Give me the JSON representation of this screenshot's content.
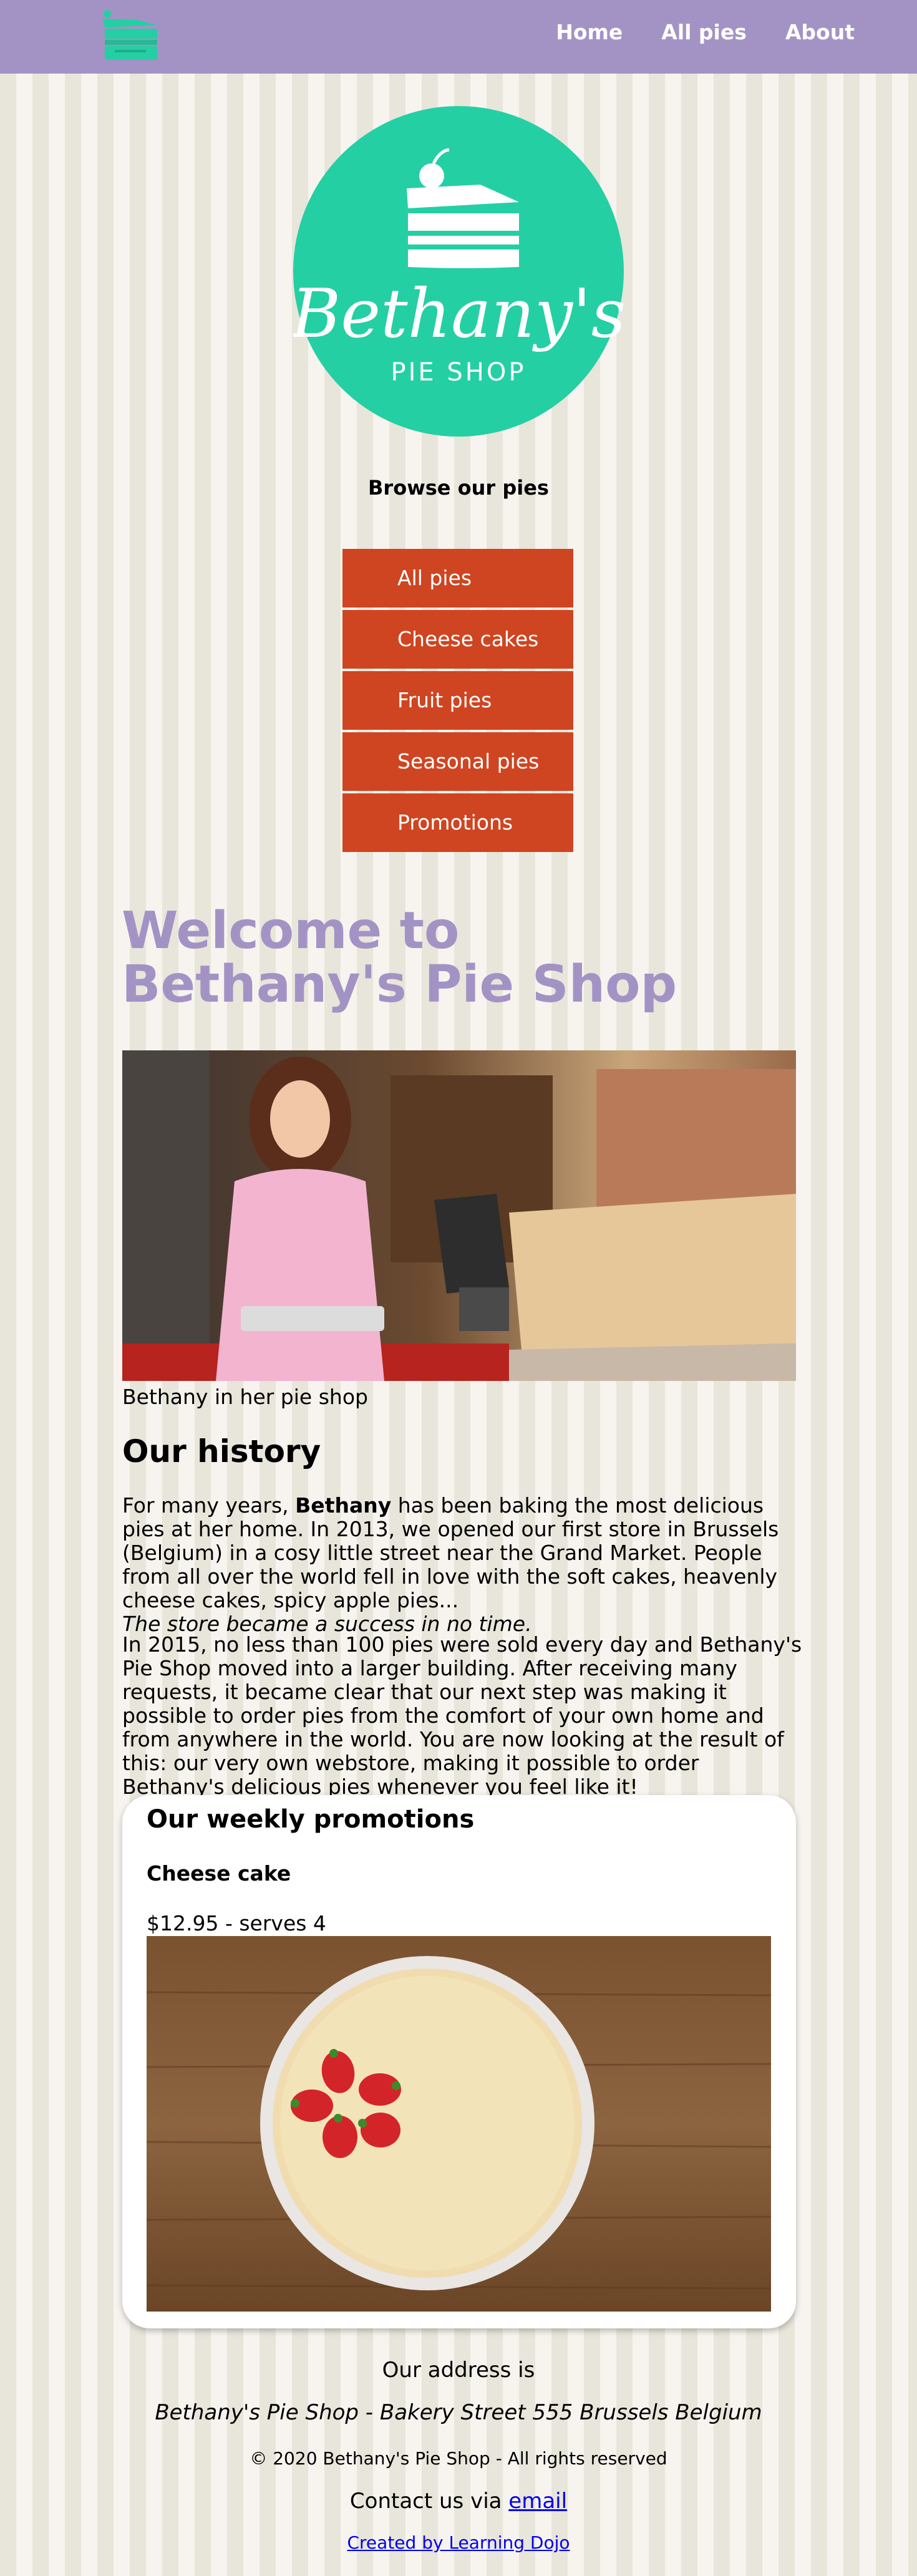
{
  "nav": {
    "logo_icon": "pie-slice-logo-icon",
    "links": [
      "Home",
      "All pies",
      "About"
    ]
  },
  "hero": {
    "brand_name": "Bethany's",
    "brand_sub": "PIE SHOP",
    "brand_color": "#24cfa4"
  },
  "browse": {
    "title": "Browse our pies",
    "categories": [
      "All pies",
      "Cheese cakes",
      "Fruit pies",
      "Seasonal pies",
      "Promotions"
    ]
  },
  "welcome": {
    "title": "Welcome to Bethany's Pie Shop",
    "photo_caption": "Bethany in her pie shop"
  },
  "history": {
    "heading": "Our history",
    "p1_before_bold": "For many years, ",
    "p1_bold": "Bethany",
    "p1_after_bold": " has been baking the most delicious pies at her home. In 2013, we opened our first store in Brussels (Belgium) in a cosy little street near the Grand Market. People from all over the world fell in love with the soft cakes, heavenly cheese cakes, spicy apple pies...",
    "p1_italic": "The store became a success in no time.",
    "p2": "In 2015, no less than 100 pies were sold every day and Bethany's Pie Shop moved into a larger building. After receiving many requests, it became clear that our next step was making it possible to order pies from the comfort of your own home and from anywhere in the world. You are now looking at the result of this: our very own webstore, making it possible to order Bethany's delicious pies whenever you feel like it!"
  },
  "promotions": {
    "heading": "Our weekly promotions",
    "item_name": "Cheese cake",
    "item_price": "$12.95 - serves 4"
  },
  "footer": {
    "address_label": "Our address is",
    "address": "Bethany's Pie Shop - Bakery Street 555 Brussels Belgium",
    "copyright": "© 2020 Bethany's Pie Shop - All rights reserved",
    "contact_prefix": "Contact us via ",
    "contact_link": "email",
    "credit": "Created by Learning Dojo"
  },
  "colors": {
    "navbar": "#a393c5",
    "menu_item": "#cf4521",
    "welcome_title": "#a393c5",
    "logo_green": "#24cfa4"
  }
}
